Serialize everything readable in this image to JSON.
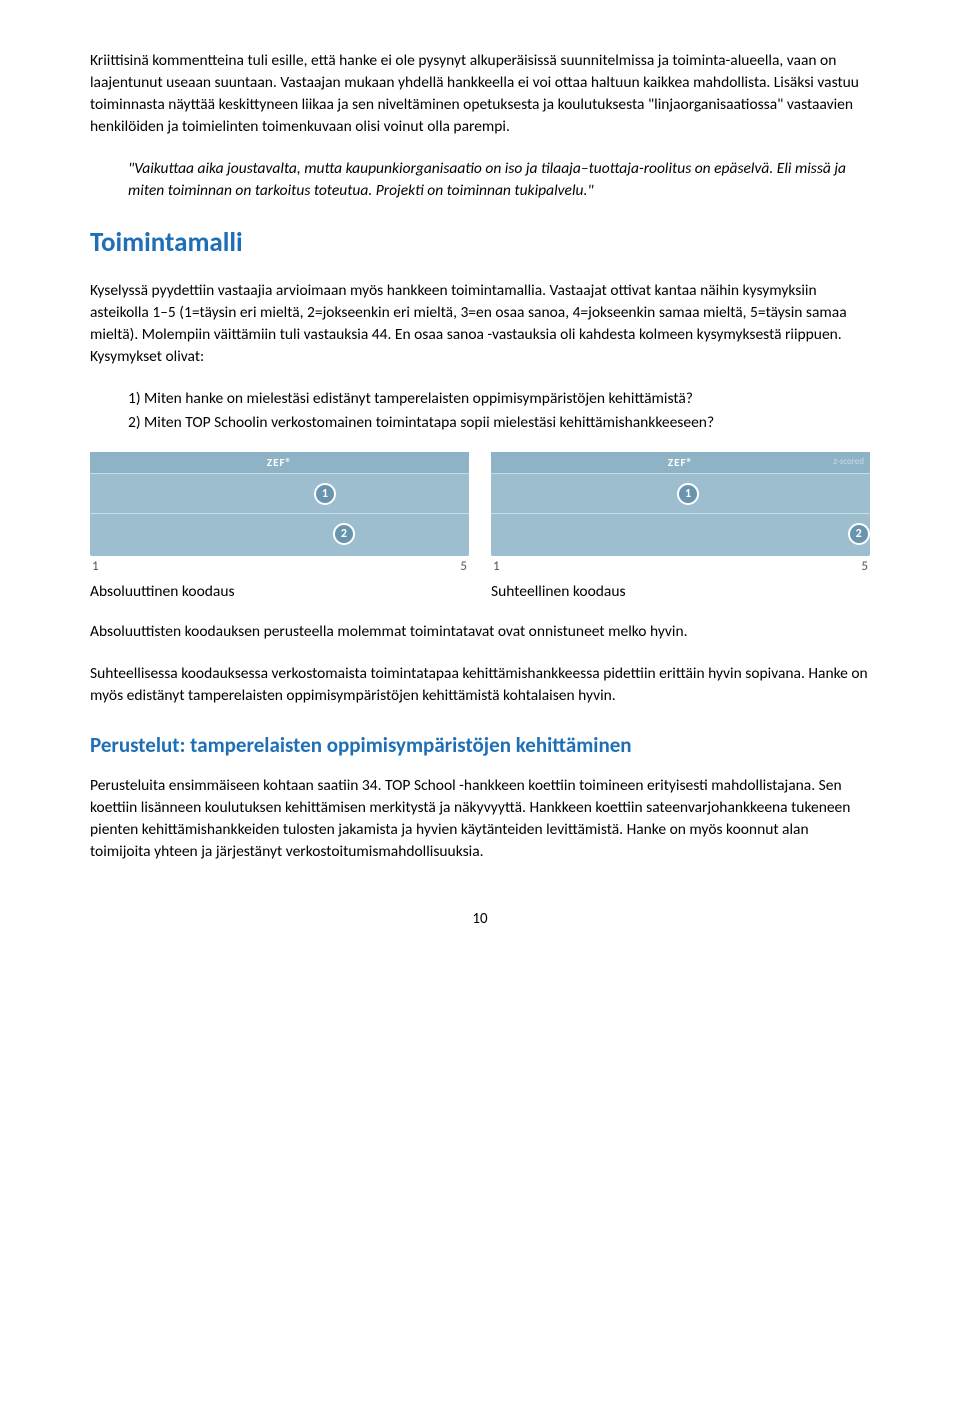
{
  "p1": "Kriittisinä kommentteina tuli esille, että hanke ei ole pysynyt alkuperäisissä suunnitelmissa ja toiminta-alueella, vaan on laajentunut useaan suuntaan. Vastaajan mukaan yhdellä hankkeella ei voi ottaa haltuun kaikkea mahdollista. Lisäksi vastuu toiminnasta näyttää keskittyneen liikaa ja sen niveltäminen opetuksesta ja koulutuksesta \"linjaorganisaatiossa\" vastaavien henkilöiden ja toimielinten toimenkuvaan olisi voinut olla parempi.",
  "quote1": "\"Vaikuttaa aika joustavalta, mutta kaupunkiorganisaatio on iso ja tilaaja–tuottaja-roolitus on epäselvä. Eli missä ja miten toiminnan on tarkoitus toteutua. Projekti on toiminnan tukipalvelu.\"",
  "h1": "Toimintamalli",
  "p2": "Kyselyssä pyydettiin vastaajia arvioimaan myös hankkeen toimintamallia. Vastaajat ottivat kantaa näihin kysymyksiin asteikolla 1–5 (1=täysin eri mieltä, 2=jokseenkin eri mieltä, 3=en osaa sanoa, 4=jokseenkin samaa mieltä, 5=täysin samaa mieltä). Molempiin väittämiin tuli vastauksia 44. En osaa sanoa -vastauksia oli kahdesta kolmeen kysymyksestä riippuen. Kysymykset olivat:",
  "q1": "1) Miten hanke on mielestäsi edistänyt tamperelaisten oppimisympäristöjen kehittämistä?",
  "q2": "2) Miten TOP Schoolin verkostomainen toimintatapa sopii mielestäsi kehittämishankkeeseen?",
  "chart_data": [
    {
      "type": "scatter",
      "title": "Absoluuttinen koodaus",
      "logo": "ZEF®",
      "xlabel_min": "1",
      "xlabel_max": "5",
      "xlim": [
        1,
        5
      ],
      "series": [
        {
          "name": "1",
          "x": 3.5,
          "pct": 62
        },
        {
          "name": "2",
          "x": 3.7,
          "pct": 67
        }
      ]
    },
    {
      "type": "scatter",
      "title": "Suhteellinen koodaus",
      "logo": "ZEF®",
      "meta": "z-scored",
      "xlabel_min": "1",
      "xlabel_max": "5",
      "xlim": [
        1,
        5
      ],
      "series": [
        {
          "name": "1",
          "x": 3.1,
          "pct": 52
        },
        {
          "name": "2",
          "x": 4.9,
          "pct": 97
        }
      ]
    }
  ],
  "p3": "Absoluuttisten koodauksen perusteella molemmat toimintatavat ovat onnistuneet melko hyvin.",
  "p4": "Suhteellisessa koodauksessa verkostomaista toimintatapaa kehittämishankkeessa pidettiin erittäin hyvin sopivana. Hanke on myös edistänyt tamperelaisten oppimisympäristöjen kehittämistä kohtalaisen hyvin.",
  "h2": "Perustelut: tamperelaisten oppimisympäristöjen kehittäminen",
  "p5": "Perusteluita ensimmäiseen kohtaan saatiin 34. TOP School -hankkeen koettiin toimineen erityisesti mahdollistajana. Sen koettiin lisänneen koulutuksen kehittämisen merkitystä ja näkyvyyttä. Hankkeen koettiin sateenvarjohankkeena tukeneen pienten kehittämishankkeiden tulosten jakamista ja hyvien käytänteiden levittämistä. Hanke on myös koonnut alan toimijoita yhteen ja järjestänyt verkostoitumismahdollisuuksia.",
  "page": "10"
}
